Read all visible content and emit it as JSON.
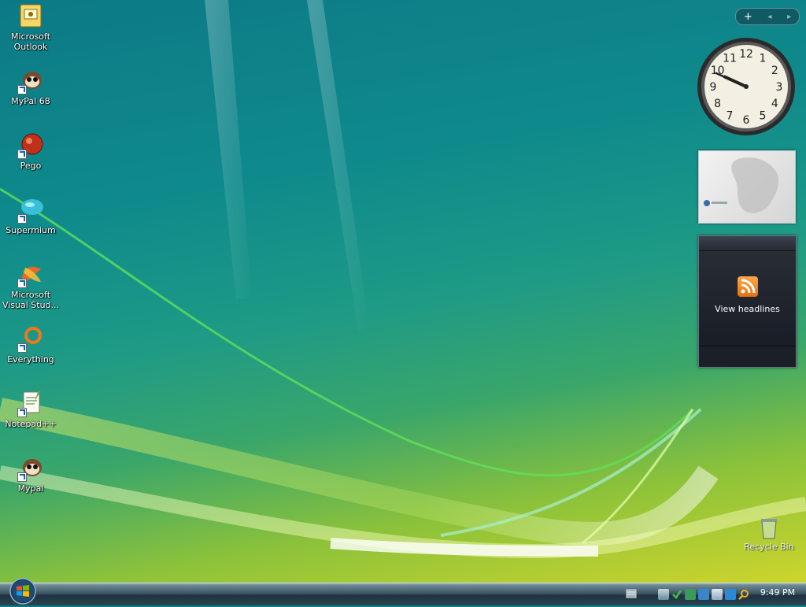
{
  "desktop": {
    "icons": [
      {
        "label": "Microsoft Outlook",
        "icon": "outlook-icon"
      },
      {
        "label": "MyPal 68",
        "icon": "mypal-icon"
      },
      {
        "label": "Pego",
        "icon": "pego-icon"
      },
      {
        "label": "Supermium",
        "icon": "supermium-icon"
      },
      {
        "label": "Microsoft Visual Stud...",
        "icon": "visual-studio-icon"
      },
      {
        "label": "Everything",
        "icon": "everything-icon"
      },
      {
        "label": "Notepad++",
        "icon": "notepadpp-icon"
      },
      {
        "label": "Mypal",
        "icon": "mypal-icon"
      }
    ],
    "recycle_bin": {
      "label": "Recycle Bin",
      "icon": "recycle-bin-icon"
    }
  },
  "sidebar": {
    "controls": {
      "add_label": "+",
      "prev_label": "◂",
      "next_label": "▸"
    },
    "clock": {
      "numbers": [
        "12",
        "1",
        "2",
        "3",
        "4",
        "5",
        "6",
        "7",
        "8",
        "9",
        "10",
        "11"
      ],
      "time": "9:49"
    },
    "slideshow": {
      "icon": "slideshow-icon"
    },
    "feed": {
      "text": "View headlines",
      "icon": "rss-icon"
    }
  },
  "taskbar": {
    "start_icon": "windows-orb-icon",
    "tray_icons": [
      "network-icon",
      "security-check-icon",
      "sync-icon",
      "monitor-icon",
      "speaker-icon",
      "update-icon",
      "search-icon"
    ],
    "time": "9:49 PM"
  },
  "colors": {
    "taskbar": "#2c4452",
    "rss": "#f28a1e",
    "wallpaper_teal": "#0f8a8c",
    "wallpaper_yellow": "#d8d82a"
  }
}
